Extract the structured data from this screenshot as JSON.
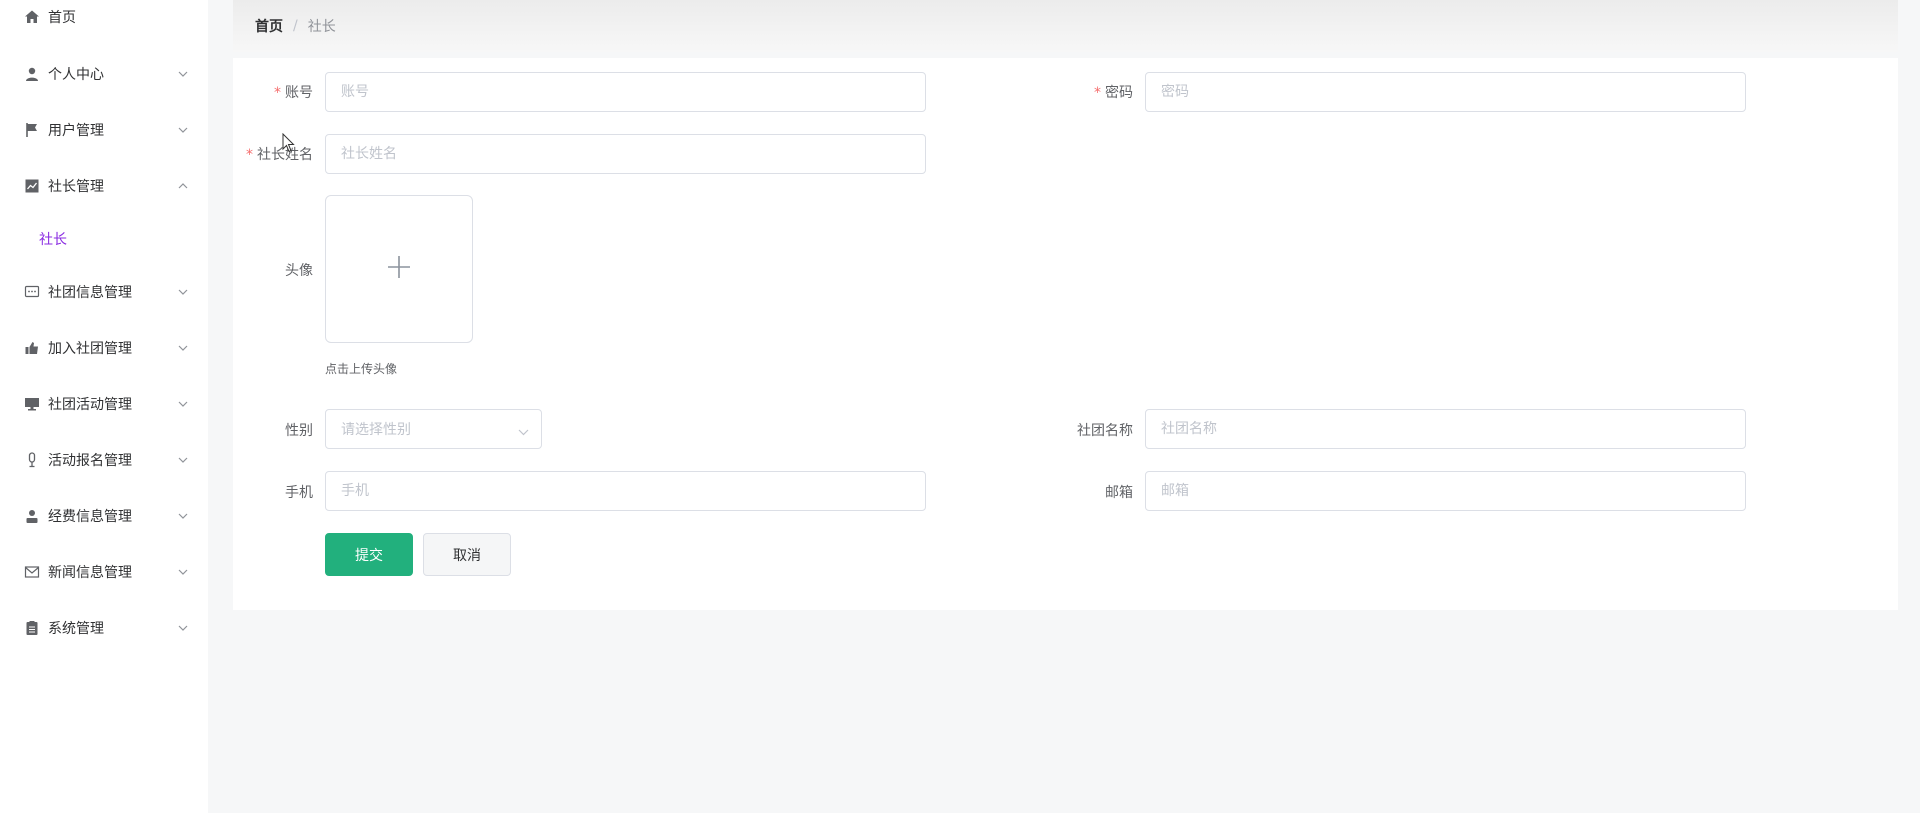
{
  "sidebar": {
    "home": {
      "label": "首页",
      "icon": "home-icon"
    },
    "items": [
      {
        "label": "个人中心",
        "icon": "user-icon",
        "expanded": false
      },
      {
        "label": "用户管理",
        "icon": "flag-icon",
        "expanded": false
      },
      {
        "label": "社长管理",
        "icon": "chart-icon",
        "expanded": true,
        "children": [
          {
            "label": "社长",
            "active": true
          }
        ]
      },
      {
        "label": "社团信息管理",
        "icon": "chat-icon",
        "expanded": false
      },
      {
        "label": "加入社团管理",
        "icon": "thumb-icon",
        "expanded": false
      },
      {
        "label": "社团活动管理",
        "icon": "monitor-icon",
        "expanded": false
      },
      {
        "label": "活动报名管理",
        "icon": "mic-icon",
        "expanded": false
      },
      {
        "label": "经费信息管理",
        "icon": "person-icon",
        "expanded": false
      },
      {
        "label": "新闻信息管理",
        "icon": "mail-icon",
        "expanded": false
      },
      {
        "label": "系统管理",
        "icon": "clipboard-icon",
        "expanded": false
      }
    ],
    "active_color": "#8a2be2"
  },
  "breadcrumb": {
    "home": "首页",
    "separator": "/",
    "current": "社长"
  },
  "form": {
    "account": {
      "label": "账号",
      "placeholder": "账号",
      "required": true
    },
    "password": {
      "label": "密码",
      "placeholder": "密码",
      "required": true
    },
    "president_name": {
      "label": "社长姓名",
      "placeholder": "社长姓名",
      "required": true
    },
    "avatar": {
      "label": "头像",
      "tip": "点击上传头像"
    },
    "gender": {
      "label": "性别",
      "placeholder": "请选择性别"
    },
    "club_name": {
      "label": "社团名称",
      "placeholder": "社团名称"
    },
    "phone": {
      "label": "手机",
      "placeholder": "手机"
    },
    "email": {
      "label": "邮箱",
      "placeholder": "邮箱"
    },
    "submit_label": "提交",
    "cancel_label": "取消"
  },
  "colors": {
    "primary": "#22b07d",
    "required": "#f56c6c"
  }
}
